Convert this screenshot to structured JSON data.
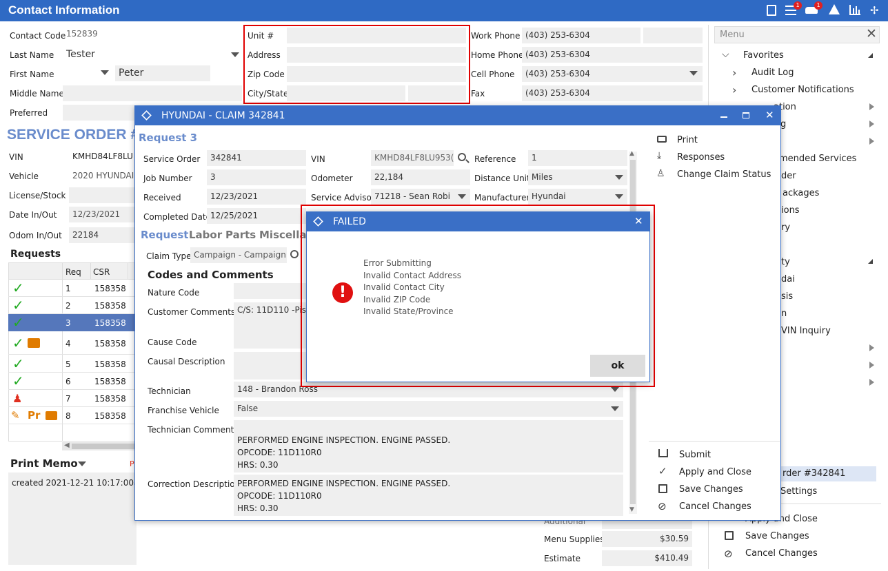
{
  "app": {
    "title": "Contact Information",
    "badge_count_1": "1",
    "badge_count_2": "1"
  },
  "contact": {
    "contact_code_label": "Contact Code",
    "contact_code": "152839",
    "last_name_label": "Last Name",
    "last_name": "Tester",
    "first_name_label": "First Name",
    "first_name": "Peter",
    "middle_name_label": "Middle Name",
    "preferred_label": "Preferred",
    "unit_label": "Unit #",
    "address_label": "Address",
    "zip_label": "Zip Code",
    "city_label": "City/State",
    "work_phone_label": "Work Phone",
    "work_phone": "(403) 253-6304",
    "home_phone_label": "Home Phone",
    "home_phone": "(403) 253-6304",
    "cell_phone_label": "Cell Phone",
    "cell_phone": "(403) 253-6304",
    "fax_label": "Fax",
    "fax": "(403) 253-6304"
  },
  "service_order": {
    "title": "SERVICE ORDER #",
    "vin_label": "VIN",
    "vin": "KMHD84LF8LU",
    "vehicle_label": "Vehicle",
    "vehicle": "2020 HYUNDAI",
    "license_label": "License/Stock",
    "date_label": "Date In/Out",
    "date": "12/23/2021",
    "odom_label": "Odom In/Out",
    "odom": "22184"
  },
  "requests": {
    "title": "Requests",
    "col_req": "Req",
    "col_csr": "CSR",
    "rows": [
      {
        "req": "1",
        "csr": "158358"
      },
      {
        "req": "2",
        "csr": "158358"
      },
      {
        "req": "3",
        "csr": "158358"
      },
      {
        "req": "4",
        "csr": "158358"
      },
      {
        "req": "5",
        "csr": "158358"
      },
      {
        "req": "6",
        "csr": "158358"
      },
      {
        "req": "7",
        "csr": "158358"
      },
      {
        "req": "8",
        "csr": "158358"
      }
    ]
  },
  "print_memo": {
    "title": "Print Memo",
    "p": "P",
    "text": "created 2021-12-21 10:17:00am"
  },
  "menu": {
    "placeholder": "Menu",
    "favorites": "Favorites",
    "audit_log": "Audit Log",
    "customer_notifications": "Customer Notifications",
    "frag_1": "ation",
    "frag_2": "g",
    "frag_3": "mended Services",
    "frag_4": "der",
    "frag_5": "ackages",
    "frag_6": "ions",
    "frag_7": "ry",
    "frag_8": "ty",
    "frag_9": "dai",
    "frag_10": "sis",
    "frag_11": "n",
    "frag_12": "VIN Inquiry",
    "frag_13": "rder #342841",
    "frag_14": "Settings",
    "apply_close": "Apply and Close",
    "save_changes": "Save Changes",
    "cancel_changes": "Cancel Changes"
  },
  "totals": {
    "additional_label": "Additional",
    "menu_supplies_label": "Menu Supplies",
    "menu_supplies": "$30.59",
    "estimate_label": "Estimate",
    "estimate": "$410.49"
  },
  "claim": {
    "title": "HYUNDAI - CLAIM 342841",
    "request_title": "Request 3",
    "service_order_label": "Service Order",
    "service_order": "342841",
    "job_number_label": "Job Number",
    "job_number": "3",
    "received_label": "Received",
    "received": "12/23/2021",
    "completed_label": "Completed Date",
    "completed": "12/25/2021",
    "vin_label": "VIN",
    "vin": "KMHD84LF8LU953(",
    "odometer_label": "Odometer",
    "odometer": "22,184",
    "advisor_label": "Service Advisor",
    "advisor": "71218 - Sean Robi",
    "reference_label": "Reference",
    "reference": "1",
    "distance_label": "Distance Unit",
    "distance": "Miles",
    "manufacturer_label": "Manufacturer",
    "manufacturer": "Hyundai",
    "tabs": [
      "Request",
      "Labor",
      "Parts",
      "Miscellan"
    ],
    "claim_type_label": "Claim Type",
    "claim_type": "Campaign - Campaign",
    "codes_title": "Codes and Comments",
    "nature_label": "Nature Code",
    "customer_comments_label": "Customer Comments",
    "customer_comments": "C/S: 11D110 -Pist",
    "cause_label": "Cause Code",
    "causal_label": "Causal Description",
    "technician_label": "Technician",
    "technician": "148 - Brandon Ross",
    "franchise_label": "Franchise Vehicle",
    "franchise": "False",
    "tech_comments_label": "Technician Comments",
    "tech_comments": [
      "PERFORMED ENGINE INSPECTION. ENGINE PASSED.",
      "OPCODE: 11D110R0",
      "HRS: 0.30"
    ],
    "correction_label": "Correction Description",
    "correction": [
      "PERFORMED ENGINE INSPECTION. ENGINE PASSED.",
      "OPCODE: 11D110R0",
      "HRS: 0.30"
    ],
    "actions": {
      "print": "Print",
      "responses": "Responses",
      "change_status": "Change Claim Status",
      "submit": "Submit",
      "apply_close": "Apply and Close",
      "save": "Save Changes",
      "cancel": "Cancel Changes"
    }
  },
  "failed": {
    "title": "FAILED",
    "messages": [
      "Error Submitting",
      "Invalid Contact Address",
      "Invalid Contact City",
      "Invalid ZIP Code",
      "Invalid State/Province"
    ],
    "ok": "ok"
  },
  "colors": {
    "header": "#2f6ac4",
    "dialog_header": "#3a6fc6",
    "accent_title": "#6a8ccc",
    "error": "#e01010",
    "check": "#22aa22",
    "orange": "#e07b00",
    "highlight": "#5577bb",
    "redbox": "#e00000"
  }
}
